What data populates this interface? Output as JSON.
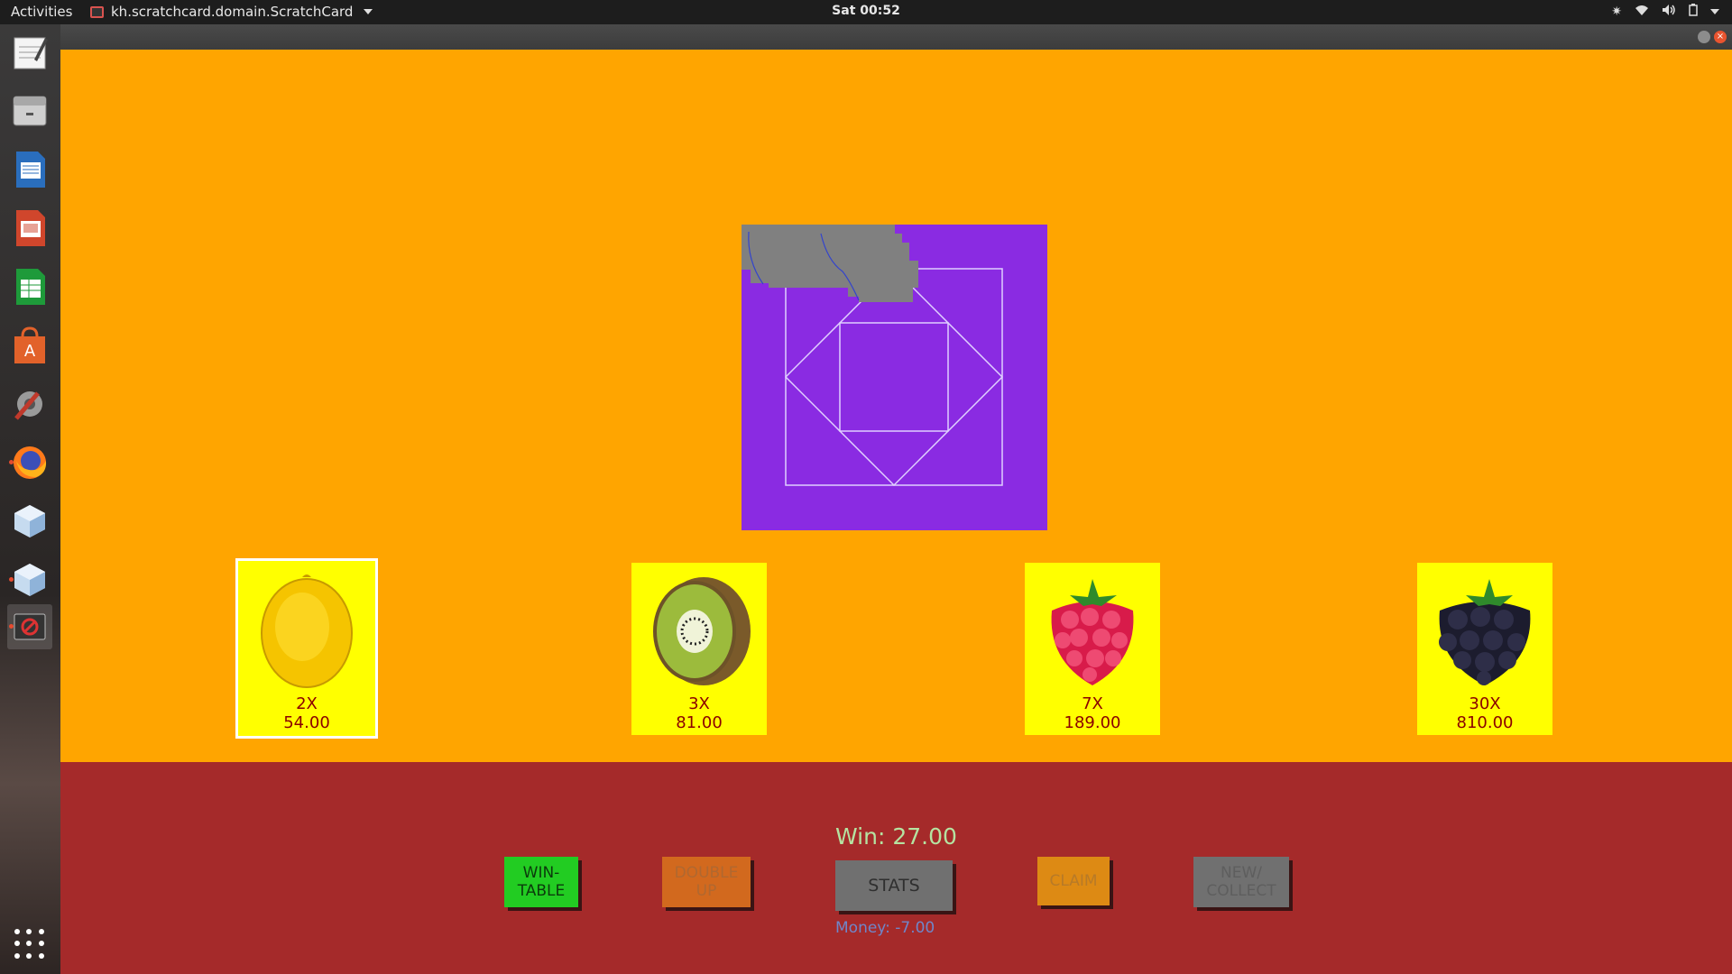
{
  "topbar": {
    "activities": "Activities",
    "app_name": "kh.scratchcard.domain.ScratchCard",
    "clock": "Sat 00:52"
  },
  "launcher": {
    "items": [
      {
        "name": "text-editor-icon",
        "color": "#f2f2f2"
      },
      {
        "name": "file-manager-icon",
        "color": "#c9c9c9"
      },
      {
        "name": "writer-icon",
        "color": "#2a6ebd"
      },
      {
        "name": "impress-icon",
        "color": "#d0462c"
      },
      {
        "name": "calc-icon",
        "color": "#1e9a3a"
      },
      {
        "name": "software-center-icon",
        "color": "#e2622a"
      },
      {
        "name": "settings-icon",
        "color": "#9a9a9a"
      },
      {
        "name": "firefox-icon",
        "color": "#ff7a1a"
      },
      {
        "name": "cube-app-icon",
        "color": "#a9c7e6"
      },
      {
        "name": "cube-app-2-icon",
        "color": "#a9c7e6"
      },
      {
        "name": "scratchcard-app-icon",
        "color": "#d33"
      }
    ]
  },
  "game": {
    "cards": [
      {
        "fruit": "lemon",
        "mult": "2X",
        "amount": "54.00",
        "selected": true
      },
      {
        "fruit": "kiwi",
        "mult": "3X",
        "amount": "81.00",
        "selected": false
      },
      {
        "fruit": "raspberry",
        "mult": "7X",
        "amount": "189.00",
        "selected": false
      },
      {
        "fruit": "blackberry",
        "mult": "30X",
        "amount": "810.00",
        "selected": false
      }
    ],
    "win": "Win: 27.00",
    "money": "Money: -7.00",
    "buttons": {
      "wintable": "WIN-\nTABLE",
      "double": "DOUBLE\nUP",
      "stats": "STATS",
      "claim": "CLAIM",
      "newcollect": "NEW/\nCOLLECT"
    }
  },
  "colors": {
    "game_bg": "#ffa500",
    "bottom_bg": "#a52a2a",
    "scratch_bg": "#8a2be2",
    "card_bg": "#ffff00"
  }
}
